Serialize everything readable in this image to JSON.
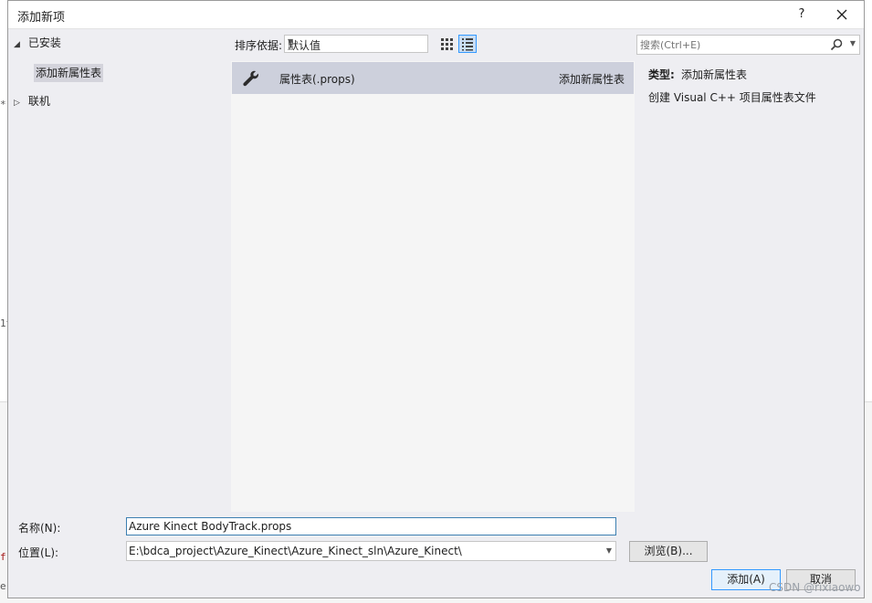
{
  "window": {
    "title": "添加新项",
    "help_label": "?",
    "close_label": "✕"
  },
  "left_tree": {
    "installed_label": "已安装",
    "installed_child": "添加新属性表",
    "online_label": "联机"
  },
  "toolbar": {
    "sort_label": "排序依据:",
    "sort_value": "默认值"
  },
  "search": {
    "placeholder": "搜索(Ctrl+E)"
  },
  "templates": [
    {
      "name": "属性表(.props)",
      "category": "添加新属性表",
      "icon": "wrench-icon"
    }
  ],
  "details": {
    "type_label": "类型:",
    "type_value": "添加新属性表",
    "description": "创建 Visual C++ 项目属性表文件"
  },
  "form": {
    "name_label": "名称(N):",
    "name_value": "Azure Kinect BodyTrack.props",
    "location_label": "位置(L):",
    "location_value": "E:\\bdca_project\\Azure_Kinect\\Azure_Kinect_sln\\Azure_Kinect\\"
  },
  "buttons": {
    "browse": "浏览(B)...",
    "add": "添加(A)",
    "cancel": "取消"
  },
  "watermark": "CSDN @rixiaowo",
  "colors": {
    "selection": "#cdd0dc",
    "accent": "#3399ff"
  }
}
